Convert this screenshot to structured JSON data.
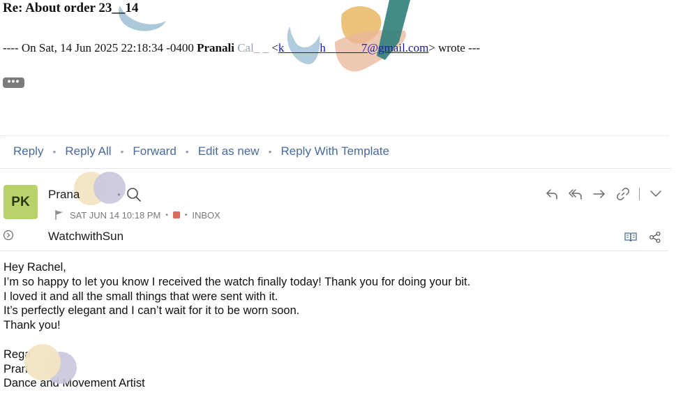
{
  "quoted": {
    "subject": "Re: About order 23__14",
    "prefix": "---- On Sat, 14 Jun 2025 22:18:34 -0400 ",
    "sender_name": "Pranali",
    "sender_name_rest": "Cal_ _",
    "lt": " <",
    "email": "k______h______7@gmail.com",
    "suffix": "> wrote ---",
    "more_label": "•••"
  },
  "actions": {
    "reply": "Reply",
    "reply_all": "Reply All",
    "forward": "Forward",
    "edit_as_new": "Edit as new",
    "reply_template": "Reply With Template",
    "separator": "•"
  },
  "message": {
    "avatar_initials": "PK",
    "sender": "Prana",
    "separator": "•",
    "date": "SAT JUN 14 10:18 PM",
    "folder": "INBOX",
    "tag": "WatchwithSun",
    "accent_color": "#b8d36a",
    "flag_color": "#d96a5c"
  },
  "body": {
    "greeting": "Hey Rachel,",
    "line1": "I’m so happy to let you know I received the watch finally today! Thank you for doing your bit.",
    "line2": "I loved it and all the small things that were sent with it.",
    "line3": "It’s perfectly elegant and I can’t wait for it to be worn soon.",
    "line4": "Thank you!",
    "regards": "Rega",
    "signature_name": "Pran",
    "signature_title": "Dance and Movement Artist"
  }
}
